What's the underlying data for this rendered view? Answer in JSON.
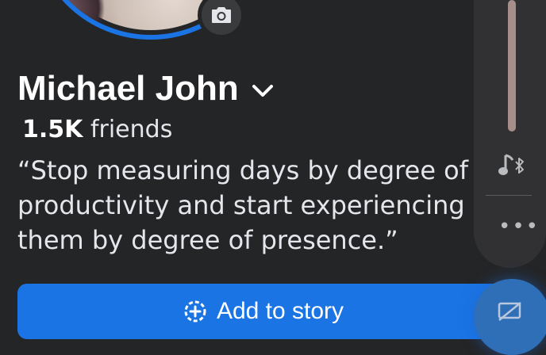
{
  "profile": {
    "name": "Michael John",
    "friends_count": "1.5K",
    "friends_label": "friends",
    "bio_lines": [
      "“Stop measuring days by degree of",
      "productivity and start experiencing",
      "them by degree of presence.”"
    ]
  },
  "actions": {
    "add_to_story": "Add to story"
  },
  "icons": {
    "camera": "camera-icon",
    "name_menu": "chevron-down-icon",
    "story_add": "add-circle-icon",
    "music_bluetooth": "music-bluetooth-icon",
    "more": "more-dots-icon",
    "cast": "cast-off-icon"
  },
  "colors": {
    "background": "#242527",
    "accent": "#1b74e4",
    "text": "#e4e6eb"
  }
}
